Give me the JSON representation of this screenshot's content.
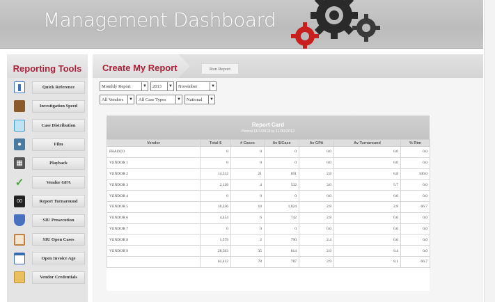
{
  "header": {
    "title": "Management Dashboard"
  },
  "sidebar": {
    "title": "Reporting Tools",
    "items": [
      {
        "label": "Quick Reference",
        "icon": "document-icon",
        "color": "#3a70c0"
      },
      {
        "label": "Investigation Speed",
        "icon": "folder-icon",
        "color": "#8a5a2a"
      },
      {
        "label": "Case Distribution",
        "icon": "chart-icon",
        "color": "#3aa0d0"
      },
      {
        "label": "Film",
        "icon": "camera-icon",
        "color": "#4a7aa0"
      },
      {
        "label": "Playback",
        "icon": "building-icon",
        "color": "#555555"
      },
      {
        "label": "Vendor GPA",
        "icon": "checkmark-icon",
        "color": "#4aa040"
      },
      {
        "label": "Report Turnaround",
        "icon": "counter-icon",
        "color": "#222222"
      },
      {
        "label": "SIU Prosecution",
        "icon": "shield-icon",
        "color": "#4a70c0"
      },
      {
        "label": "SIU Open Cases",
        "icon": "clipboard-icon",
        "color": "#c08040"
      },
      {
        "label": "Open Invoice Age",
        "icon": "calendar-icon",
        "color": "#3a6ab0"
      },
      {
        "label": "Vendor Credentials",
        "icon": "folder-lock-icon",
        "color": "#c09030"
      }
    ]
  },
  "main": {
    "title": "Create My Report",
    "run_button": "Run Report",
    "filters": {
      "report_type": "Monthly Report",
      "year": "2013",
      "month": "November",
      "vendor": "All Vendors",
      "case_type": "All Case Types",
      "region": "National"
    }
  },
  "report": {
    "title": "Report Card",
    "period": "Period 11/1/2013 to 11/30/2013",
    "columns": [
      "Vendor",
      "Total $",
      "# Cases",
      "Av $/Case",
      "Av GPA",
      "Av Turnaround",
      "% Rtm"
    ],
    "rows": [
      [
        "FRADCO",
        "0",
        "0",
        "0",
        "0.0",
        "0.0",
        "0.0"
      ],
      [
        "VENDOR 1",
        "0",
        "0",
        "0",
        "0.0",
        "0.0",
        "0.0"
      ],
      [
        "VENDOR 2",
        "14,512",
        "21",
        "691",
        "2.8",
        "6.8",
        "100.0"
      ],
      [
        "VENDOR 3",
        "2,128",
        "4",
        "532",
        "3.0",
        "5.7",
        "0.0"
      ],
      [
        "VENDOR 4",
        "0",
        "0",
        "0",
        "0.0",
        "0.0",
        "0.0"
      ],
      [
        "VENDOR 5",
        "10,236",
        "10",
        "1,024",
        "2.8",
        "2.8",
        "66.7"
      ],
      [
        "VENDOR 6",
        "4,454",
        "6",
        "742",
        "2.8",
        "0.0",
        "0.0"
      ],
      [
        "VENDOR 7",
        "0",
        "0",
        "0",
        "0.0",
        "0.0",
        "0.0"
      ],
      [
        "VENDOR 8",
        "1,579",
        "2",
        "790",
        "2.4",
        "0.0",
        "0.0"
      ],
      [
        "VENDOR 9",
        "28,503",
        "35",
        "814",
        "2.9",
        "9.4",
        "0.0"
      ]
    ],
    "totals": [
      "",
      "61,412",
      "78",
      "787",
      "2.9",
      "8.1",
      "66.7"
    ]
  },
  "colors": {
    "accent": "#a8233a",
    "gear_red": "#c8201e",
    "gear_dark": "#2a2a2a"
  }
}
